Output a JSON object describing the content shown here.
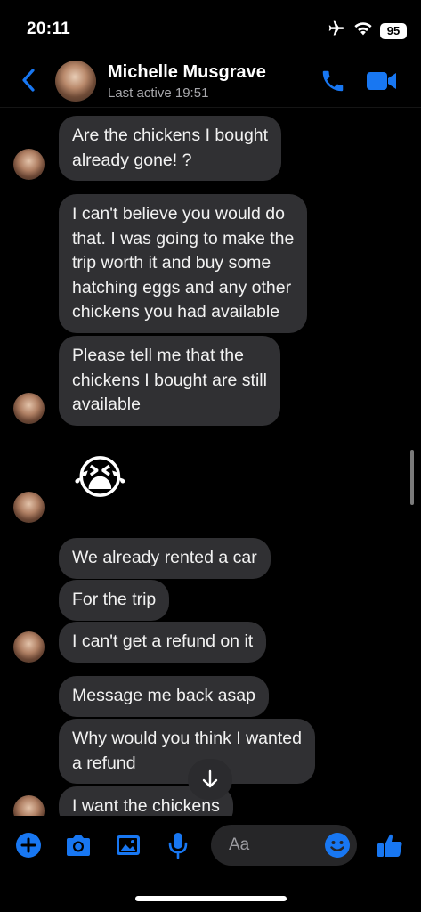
{
  "status_bar": {
    "time": "20:11",
    "battery": "95"
  },
  "header": {
    "name": "Michelle Musgrave",
    "subtitle": "Last active 19:51"
  },
  "messages": [
    "Are the chickens I bought\nalready gone! ?",
    "I can't believe you would do\nthat. I was going to make the\ntrip worth it and buy some\nhatching eggs and any other\nchickens you had available",
    "Please tell me that the\nchickens I bought are still\navailable",
    "We already rented a car",
    "For the trip",
    "I can't get a refund on it",
    "Message me back asap",
    "Why would you think I wanted\na refund",
    "I want the chickens"
  ],
  "emoji_message": "😭",
  "composer": {
    "placeholder": "Aa"
  },
  "colors": {
    "accent": "#1877f2",
    "bubble": "#303033",
    "background": "#000000"
  }
}
